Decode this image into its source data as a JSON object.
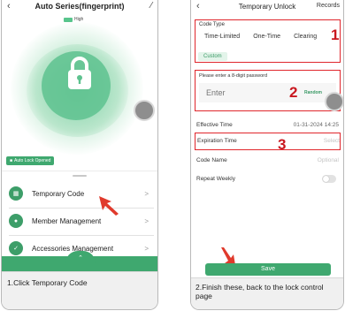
{
  "left_panel": {
    "title": "Auto Series(fingerprint)",
    "battery_label": "High",
    "auto_lock_label": "Auto Lock Opened",
    "menu": [
      {
        "label": "Temporary Code",
        "icon": "grid-icon"
      },
      {
        "label": "Member Management",
        "icon": "person-icon"
      },
      {
        "label": "Accessories Management",
        "icon": "wrench-icon"
      }
    ],
    "chevron": ">",
    "caption": "1.Click Temporary Code"
  },
  "right_panel": {
    "title": "Temporary Unlock",
    "records_label": "Records",
    "code_type_label": "Code Type",
    "code_types": [
      "Time-Limited",
      "One-Time",
      "Clearing"
    ],
    "custom_label": "Custom",
    "password_label": "Please enter a 8-digit password",
    "password_placeholder": "Enter",
    "random_label": "Random",
    "effective_time_label": "Effective Time",
    "effective_time_value": "01-31-2024 14:25",
    "expiration_time_label": "Expiration Time",
    "expiration_time_value": "Select",
    "code_name_label": "Code Name",
    "code_name_placeholder": "Optional",
    "repeat_weekly_label": "Repeat Weekly",
    "save_label": "Save",
    "caption": "2.Finish these, back to the lock control page"
  },
  "step_numbers": [
    "1",
    "2",
    "3"
  ],
  "colors": {
    "accent_green": "#3fa86f",
    "highlight_red": "#e0262c",
    "arrow_red": "#e03a2c"
  }
}
